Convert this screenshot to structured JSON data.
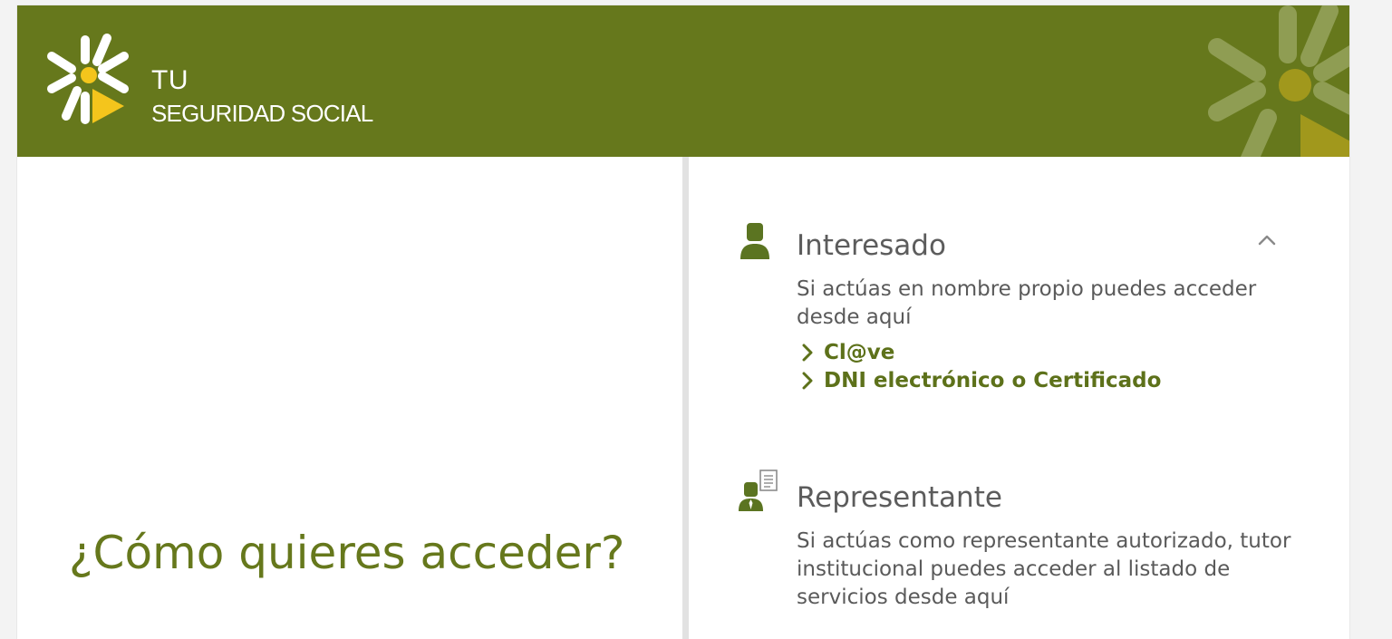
{
  "brand": {
    "line1": "TU",
    "line2": "SEGURIDAD SOCIAL",
    "primary_color": "#66781c",
    "accent_color": "#f4c51c",
    "logo_icon": "seguridad-social-snowflake-logo"
  },
  "main": {
    "title": "¿Cómo quieres acceder?"
  },
  "options": {
    "interesado": {
      "icon": "person-icon",
      "title": "Interesado",
      "description": "Si actúas en nombre propio puedes acceder desde aquí",
      "expanded": true,
      "links": [
        {
          "label": "Cl@ve"
        },
        {
          "label": "DNI electrónico o Certificado"
        }
      ]
    },
    "representante": {
      "icon": "representative-document-icon",
      "title": "Representante",
      "description": "Si actúas como representante autorizado, tutor institucional puedes acceder al listado de servicios desde aquí"
    }
  }
}
